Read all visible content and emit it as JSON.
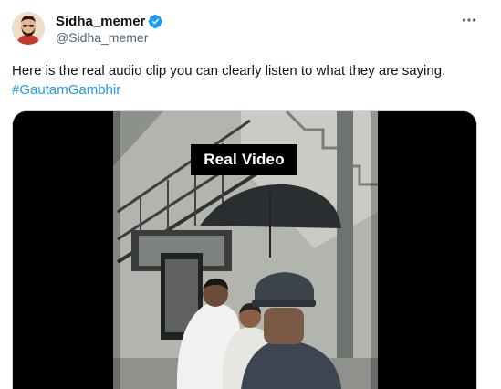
{
  "tweet": {
    "author": {
      "display_name": "Sidha_memer",
      "handle": "@Sidha_memer",
      "verified": true,
      "verified_color": "#1d9bf0"
    },
    "text": "Here is the real audio clip you can clearly listen to what they are saying.",
    "hashtag": "#GautamGambhir",
    "hashtag_color": "#1d9bf0",
    "more_icon": "more-horizontal-icon",
    "media": {
      "type": "video",
      "overlay_label": "Real Video"
    }
  }
}
